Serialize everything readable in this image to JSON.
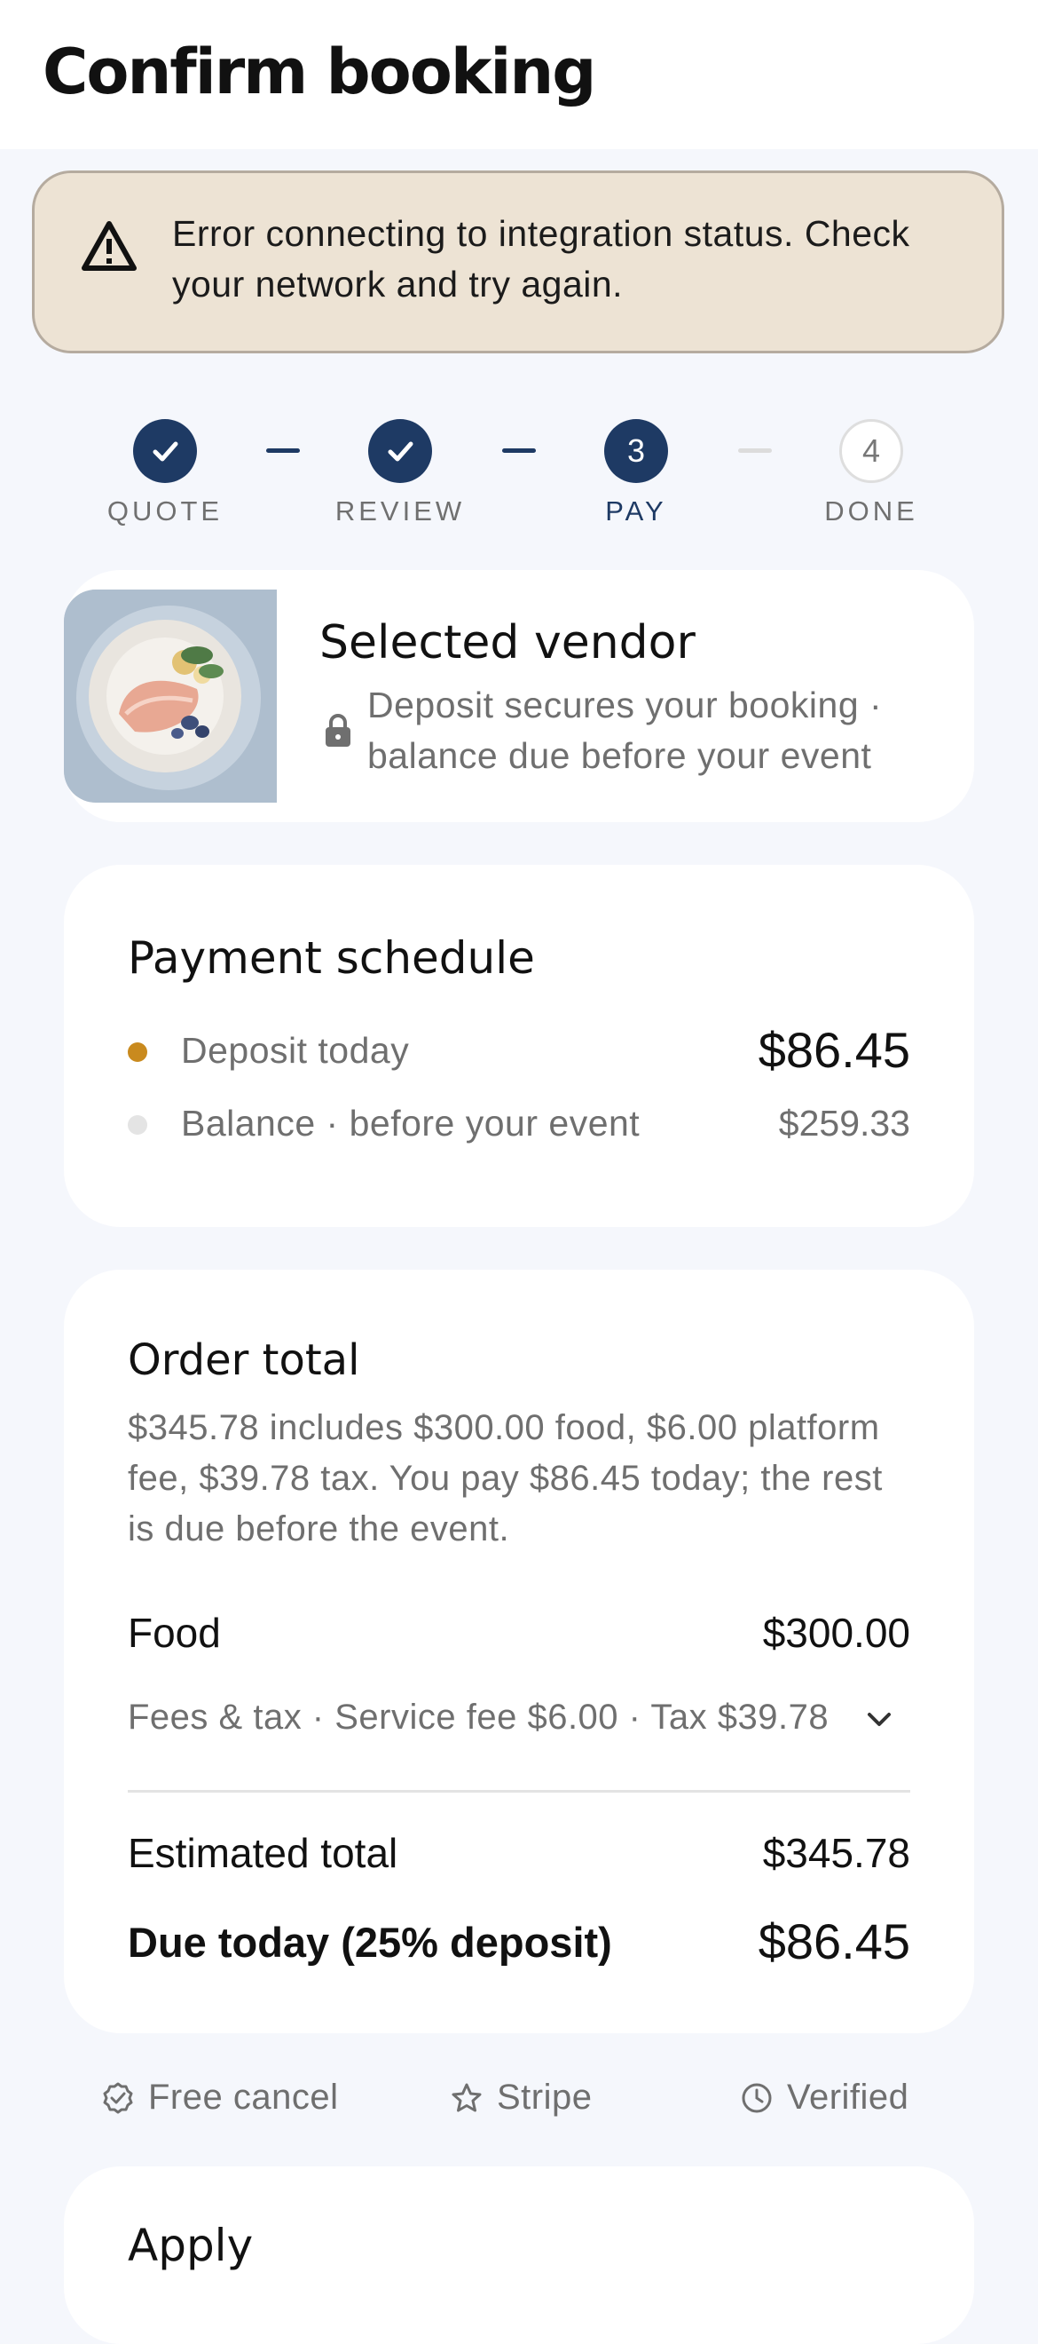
{
  "header": {
    "title": "Confirm booking"
  },
  "alert": {
    "icon": "warning-icon",
    "message": "Error connecting to integration status. Check your network and try again."
  },
  "stepper": {
    "steps": [
      {
        "label": "QUOTE",
        "state": "complete",
        "number": ""
      },
      {
        "label": "REVIEW",
        "state": "complete",
        "number": ""
      },
      {
        "label": "PAY",
        "state": "active",
        "number": "3"
      },
      {
        "label": "DONE",
        "state": "pending",
        "number": "4"
      }
    ],
    "accent": "#1e3a64"
  },
  "vendor": {
    "title": "Selected vendor",
    "subtitle": "Deposit secures your booking · balance due before your event",
    "icon": "lock-icon"
  },
  "schedule": {
    "title": "Payment schedule",
    "rows": [
      {
        "label": "Deposit today",
        "amount": "$86.45",
        "dot_color": "#c98a1e"
      },
      {
        "label": "Balance · before your event",
        "amount": "$259.33",
        "dot_color": "#e4e4e4"
      }
    ]
  },
  "order": {
    "title": "Order total",
    "description": "$345.78 includes $300.00 food, $6.00 platform fee, $39.78 tax. You pay $86.45 today; the rest is due before the event.",
    "food_label": "Food",
    "food_amount": "$300.00",
    "fees_label": "Fees & tax · Service fee $6.00 · Tax $39.78",
    "estimated_label": "Estimated total",
    "estimated_amount": "$345.78",
    "due_label": "Due today (25% deposit)",
    "due_amount": "$86.45"
  },
  "trust": [
    {
      "label": "Free cancel",
      "icon": "badge-check-icon"
    },
    {
      "label": "Stripe",
      "icon": "star-icon"
    },
    {
      "label": "Verified",
      "icon": "clock-icon"
    }
  ],
  "next_section": {
    "title": "Apply"
  }
}
